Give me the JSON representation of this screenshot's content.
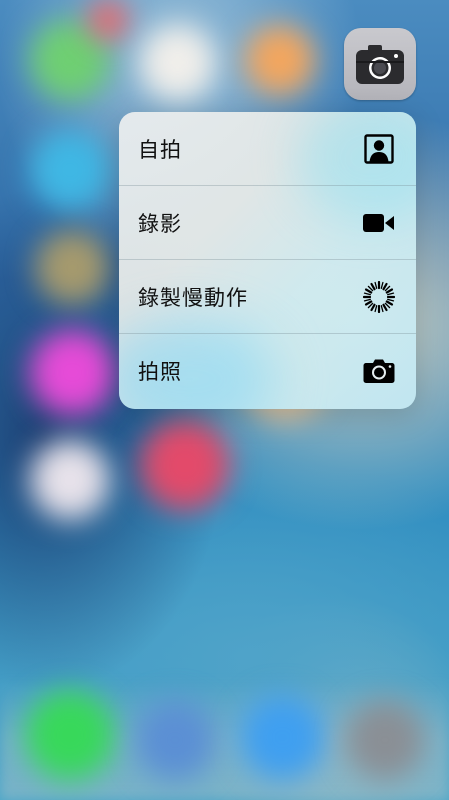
{
  "app_icon": {
    "name": "camera-app-icon"
  },
  "quick_actions": [
    {
      "label": "自拍",
      "icon": "selfie-portrait-icon"
    },
    {
      "label": "錄影",
      "icon": "video-camera-icon"
    },
    {
      "label": "錄製慢動作",
      "icon": "slow-motion-icon"
    },
    {
      "label": "拍照",
      "icon": "photo-camera-icon"
    }
  ],
  "colors": {
    "menu_text": "#111111",
    "icon_glyph": "#000000",
    "camera_icon_bg": "#c0c0c6"
  }
}
